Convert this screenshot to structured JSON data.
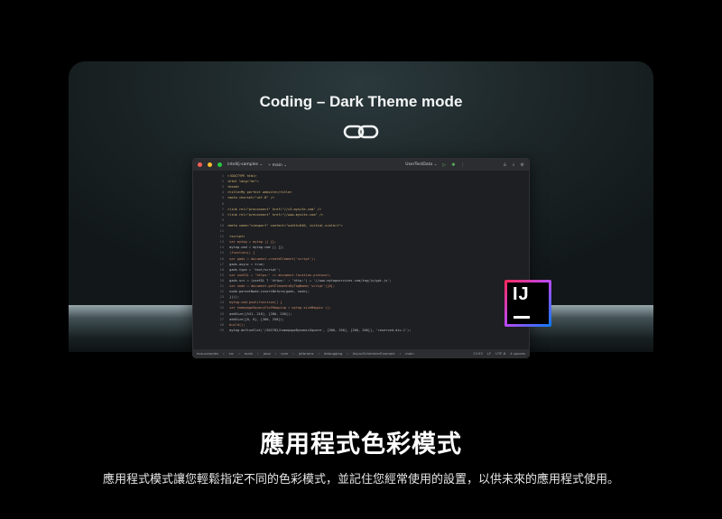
{
  "card": {
    "title": "Coding – Dark Theme mode",
    "icon": "link-icon"
  },
  "ide": {
    "project": "intellij-samples",
    "branch": "main",
    "run_config": "UserTestData",
    "code": [
      {
        "n": "1",
        "t": "<!DOCTYPE html>"
      },
      {
        "n": "2",
        "t": "<html lang=\"en\">"
      },
      {
        "n": "3",
        "t": "<head>"
      },
      {
        "n": "4",
        "t": "<title>My perfect website</title>"
      },
      {
        "n": "5",
        "t": "<meta charset=\"utf-8\" />"
      },
      {
        "n": "6",
        "t": ""
      },
      {
        "n": "7",
        "t": "<link rel=\"preconnect\" href=\"//c3.mysite.com\" />"
      },
      {
        "n": "8",
        "t": "<link rel=\"preconnect\" href=\"//www.mysite.com\" />"
      },
      {
        "n": "9",
        "t": ""
      },
      {
        "n": "10",
        "t": "<meta name=\"viewport\" content=\"width=640, initial-scale=1\">"
      },
      {
        "n": "11",
        "t": ""
      },
      {
        "n": "12",
        "t": "        <script>"
      },
      {
        "n": "13",
        "t": "        var mytag = mytag || {};"
      },
      {
        "n": "14",
        "t": "        mytag.cmd = mytag.cmd || [];"
      },
      {
        "n": "15",
        "t": "        (function() {"
      },
      {
        "n": "16",
        "t": "            var gads = document.createElement('script');"
      },
      {
        "n": "17",
        "t": "            gads.async = true;"
      },
      {
        "n": "18",
        "t": "            gads.type = 'text/script';"
      },
      {
        "n": "19",
        "t": "            var useSSL = 'https:' == document.location.protocol;"
      },
      {
        "n": "20",
        "t": "            gads.src = (useSSL ? 'https:' : 'http:') + '//www.mytagservices.com/tag/js/gpt.js';"
      },
      {
        "n": "21",
        "t": "            var node = document.getElementsByTagName('script')[0];"
      },
      {
        "n": "22",
        "t": "            node.parentNode.insertBefore(gads, node);"
      },
      {
        "n": "23",
        "t": "        })();"
      },
      {
        "n": "24",
        "t": "        mytag.cmd.push(function() {"
      },
      {
        "n": "25",
        "t": "        var homepageSquarySlotMapping = mytag.sizeMappin  ();"
      },
      {
        "n": "26",
        "t": "        addSize([541, 210], [200, 250]);"
      },
      {
        "n": "27",
        "t": "        addSize([0, 0], [300, 250]);"
      },
      {
        "n": "28",
        "t": "        build();"
      },
      {
        "n": "29",
        "t": "        mytag.defineSlot('/202782/homepageDynamicSquare', [300, 250], [200, 200]], 'reserved-div-1');"
      }
    ],
    "status": {
      "path": [
        "eva-samples",
        "src",
        "main",
        "java",
        "com",
        "jetbrains",
        "debugging",
        "AsyncSchedulerExample",
        "main"
      ],
      "pos": "13:53",
      "eol": "LF",
      "enc": "UTF-8",
      "indent": "4 spaces"
    }
  },
  "logo": {
    "text": "IJ"
  },
  "heading": "應用程式色彩模式",
  "description": "應用程式模式讓您輕鬆指定不同的色彩模式，並記住您經常使用的設置，以供未來的應用程式使用。"
}
